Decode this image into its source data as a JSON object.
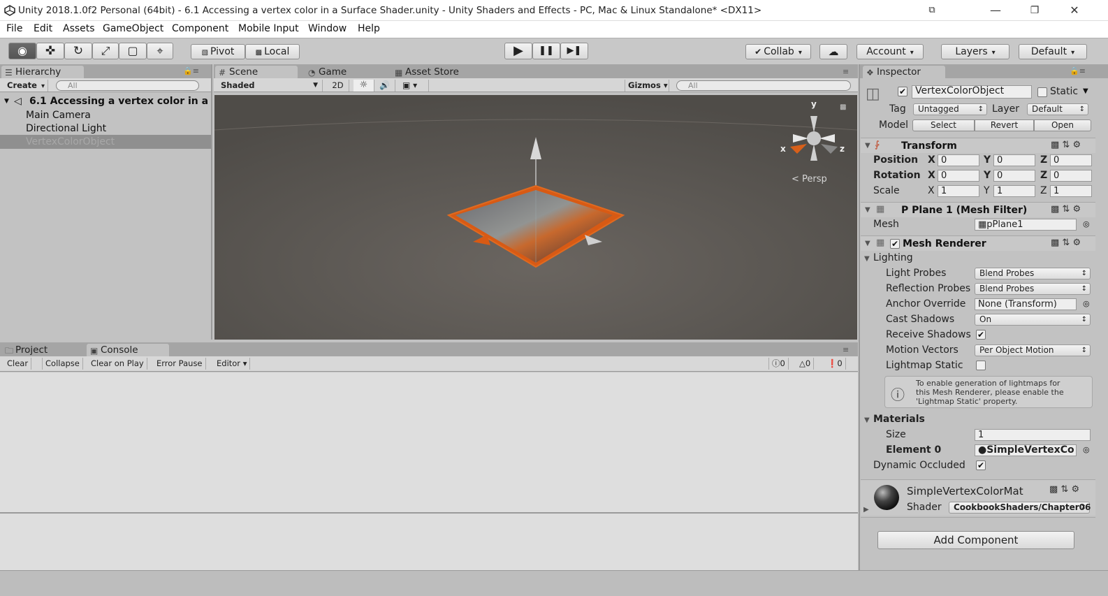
{
  "window": {
    "title": "Unity 2018.1.0f2 Personal (64bit) - 6.1 Accessing a vertex color in a Surface Shader.unity - Unity Shaders and Effects - PC, Mac & Linux Standalone* <DX11>",
    "controls": [
      "⧉",
      "—",
      "❐",
      "✕"
    ]
  },
  "menu": [
    "File",
    "Edit",
    "Assets",
    "GameObject",
    "Component",
    "Mobile Input",
    "Window",
    "Help"
  ],
  "toolbar": {
    "tools": [
      "◉",
      "✜",
      "↻",
      "⤢",
      "▢",
      "⌖"
    ],
    "pivot": "Pivot",
    "local": "Local",
    "play": "▶",
    "pause": "❚❚",
    "step": "▶❚",
    "collab": "Collab",
    "cloud": "☁",
    "account": "Account",
    "layers": "Layers",
    "layout": "Default"
  },
  "hierarchy": {
    "tab": "Hierarchy",
    "create": "Create",
    "search": "All",
    "scene": "6.1 Accessing a vertex color in a",
    "items": [
      "Main Camera",
      "Directional Light",
      "VertexColorObject"
    ]
  },
  "scene": {
    "tabs": [
      "Scene",
      "Game",
      "Asset Store"
    ],
    "shading": "Shaded",
    "mode2d": "2D",
    "gizmos": "Gizmos",
    "search": "All",
    "persp": "Persp",
    "axes": {
      "x": "x",
      "y": "y",
      "z": "z"
    }
  },
  "console": {
    "tabs": [
      "Project",
      "Console"
    ],
    "buttons": [
      "Clear",
      "Collapse",
      "Clear on Play",
      "Error Pause",
      "Editor"
    ],
    "counts": [
      "0",
      "0",
      "0"
    ]
  },
  "inspector": {
    "tab": "Inspector",
    "object_name": "VertexColorObject",
    "static": "Static",
    "tag_label": "Tag",
    "tag": "Untagged",
    "layer_label": "Layer",
    "layer": "Default",
    "model_label": "Model",
    "model_buttons": [
      "Select",
      "Revert",
      "Open"
    ],
    "transform": {
      "title": "Transform",
      "rows": [
        {
          "label": "Position",
          "x": "0",
          "y": "0",
          "z": "0"
        },
        {
          "label": "Rotation",
          "x": "0",
          "y": "0",
          "z": "0"
        },
        {
          "label": "Scale",
          "x": "1",
          "y": "1",
          "z": "1"
        }
      ],
      "axis": [
        "X",
        "Y",
        "Z"
      ]
    },
    "mesh_filter": {
      "title": "P Plane 1 (Mesh Filter)",
      "mesh_label": "Mesh",
      "mesh": "pPlane1"
    },
    "mesh_renderer": {
      "title": "Mesh Renderer",
      "lighting": "Lighting",
      "light_probes_label": "Light Probes",
      "light_probes": "Blend Probes",
      "reflection_probes_label": "Reflection Probes",
      "reflection_probes": "Blend Probes",
      "anchor_label": "Anchor Override",
      "anchor": "None (Transform)",
      "cast_shadows_label": "Cast Shadows",
      "cast_shadows": "On",
      "receive_shadows_label": "Receive Shadows",
      "motion_vectors_label": "Motion Vectors",
      "motion_vectors": "Per Object Motion",
      "lightmap_static_label": "Lightmap Static",
      "info": [
        "To enable generation of lightmaps for",
        "this Mesh Renderer, please enable the",
        "'Lightmap Static' property."
      ],
      "materials": "Materials",
      "size_label": "Size",
      "size": "1",
      "element0_label": "Element 0",
      "element0": "SimpleVertexCo",
      "dynamic_occluded_label": "Dynamic Occluded"
    },
    "material": {
      "name": "SimpleVertexColorMat",
      "shader_label": "Shader",
      "shader": "CookbookShaders/Chapter06"
    },
    "add_component": "Add Component"
  }
}
